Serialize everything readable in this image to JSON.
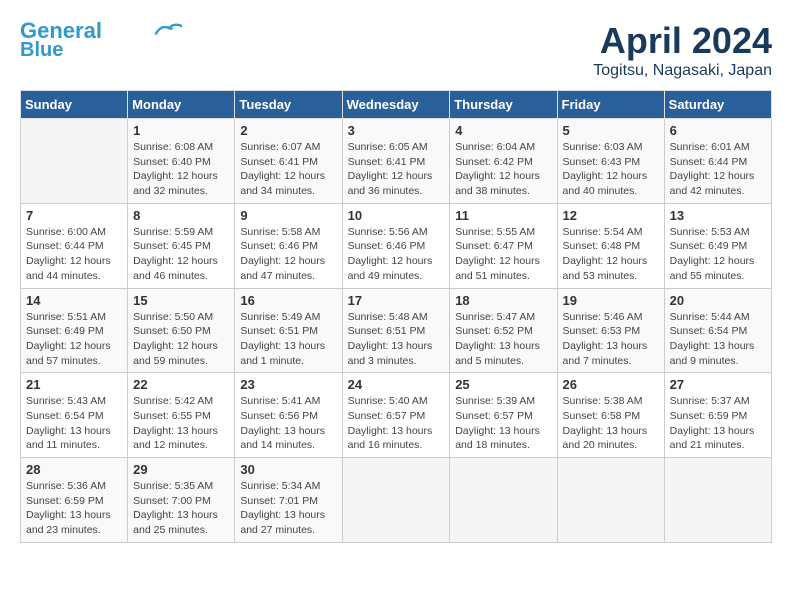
{
  "logo": {
    "line1": "General",
    "line2": "Blue"
  },
  "title": "April 2024",
  "subtitle": "Togitsu, Nagasaki, Japan",
  "days_header": [
    "Sunday",
    "Monday",
    "Tuesday",
    "Wednesday",
    "Thursday",
    "Friday",
    "Saturday"
  ],
  "weeks": [
    [
      {
        "day": "",
        "info": ""
      },
      {
        "day": "1",
        "info": "Sunrise: 6:08 AM\nSunset: 6:40 PM\nDaylight: 12 hours\nand 32 minutes."
      },
      {
        "day": "2",
        "info": "Sunrise: 6:07 AM\nSunset: 6:41 PM\nDaylight: 12 hours\nand 34 minutes."
      },
      {
        "day": "3",
        "info": "Sunrise: 6:05 AM\nSunset: 6:41 PM\nDaylight: 12 hours\nand 36 minutes."
      },
      {
        "day": "4",
        "info": "Sunrise: 6:04 AM\nSunset: 6:42 PM\nDaylight: 12 hours\nand 38 minutes."
      },
      {
        "day": "5",
        "info": "Sunrise: 6:03 AM\nSunset: 6:43 PM\nDaylight: 12 hours\nand 40 minutes."
      },
      {
        "day": "6",
        "info": "Sunrise: 6:01 AM\nSunset: 6:44 PM\nDaylight: 12 hours\nand 42 minutes."
      }
    ],
    [
      {
        "day": "7",
        "info": "Sunrise: 6:00 AM\nSunset: 6:44 PM\nDaylight: 12 hours\nand 44 minutes."
      },
      {
        "day": "8",
        "info": "Sunrise: 5:59 AM\nSunset: 6:45 PM\nDaylight: 12 hours\nand 46 minutes."
      },
      {
        "day": "9",
        "info": "Sunrise: 5:58 AM\nSunset: 6:46 PM\nDaylight: 12 hours\nand 47 minutes."
      },
      {
        "day": "10",
        "info": "Sunrise: 5:56 AM\nSunset: 6:46 PM\nDaylight: 12 hours\nand 49 minutes."
      },
      {
        "day": "11",
        "info": "Sunrise: 5:55 AM\nSunset: 6:47 PM\nDaylight: 12 hours\nand 51 minutes."
      },
      {
        "day": "12",
        "info": "Sunrise: 5:54 AM\nSunset: 6:48 PM\nDaylight: 12 hours\nand 53 minutes."
      },
      {
        "day": "13",
        "info": "Sunrise: 5:53 AM\nSunset: 6:49 PM\nDaylight: 12 hours\nand 55 minutes."
      }
    ],
    [
      {
        "day": "14",
        "info": "Sunrise: 5:51 AM\nSunset: 6:49 PM\nDaylight: 12 hours\nand 57 minutes."
      },
      {
        "day": "15",
        "info": "Sunrise: 5:50 AM\nSunset: 6:50 PM\nDaylight: 12 hours\nand 59 minutes."
      },
      {
        "day": "16",
        "info": "Sunrise: 5:49 AM\nSunset: 6:51 PM\nDaylight: 13 hours\nand 1 minute."
      },
      {
        "day": "17",
        "info": "Sunrise: 5:48 AM\nSunset: 6:51 PM\nDaylight: 13 hours\nand 3 minutes."
      },
      {
        "day": "18",
        "info": "Sunrise: 5:47 AM\nSunset: 6:52 PM\nDaylight: 13 hours\nand 5 minutes."
      },
      {
        "day": "19",
        "info": "Sunrise: 5:46 AM\nSunset: 6:53 PM\nDaylight: 13 hours\nand 7 minutes."
      },
      {
        "day": "20",
        "info": "Sunrise: 5:44 AM\nSunset: 6:54 PM\nDaylight: 13 hours\nand 9 minutes."
      }
    ],
    [
      {
        "day": "21",
        "info": "Sunrise: 5:43 AM\nSunset: 6:54 PM\nDaylight: 13 hours\nand 11 minutes."
      },
      {
        "day": "22",
        "info": "Sunrise: 5:42 AM\nSunset: 6:55 PM\nDaylight: 13 hours\nand 12 minutes."
      },
      {
        "day": "23",
        "info": "Sunrise: 5:41 AM\nSunset: 6:56 PM\nDaylight: 13 hours\nand 14 minutes."
      },
      {
        "day": "24",
        "info": "Sunrise: 5:40 AM\nSunset: 6:57 PM\nDaylight: 13 hours\nand 16 minutes."
      },
      {
        "day": "25",
        "info": "Sunrise: 5:39 AM\nSunset: 6:57 PM\nDaylight: 13 hours\nand 18 minutes."
      },
      {
        "day": "26",
        "info": "Sunrise: 5:38 AM\nSunset: 6:58 PM\nDaylight: 13 hours\nand 20 minutes."
      },
      {
        "day": "27",
        "info": "Sunrise: 5:37 AM\nSunset: 6:59 PM\nDaylight: 13 hours\nand 21 minutes."
      }
    ],
    [
      {
        "day": "28",
        "info": "Sunrise: 5:36 AM\nSunset: 6:59 PM\nDaylight: 13 hours\nand 23 minutes."
      },
      {
        "day": "29",
        "info": "Sunrise: 5:35 AM\nSunset: 7:00 PM\nDaylight: 13 hours\nand 25 minutes."
      },
      {
        "day": "30",
        "info": "Sunrise: 5:34 AM\nSunset: 7:01 PM\nDaylight: 13 hours\nand 27 minutes."
      },
      {
        "day": "",
        "info": ""
      },
      {
        "day": "",
        "info": ""
      },
      {
        "day": "",
        "info": ""
      },
      {
        "day": "",
        "info": ""
      }
    ]
  ]
}
